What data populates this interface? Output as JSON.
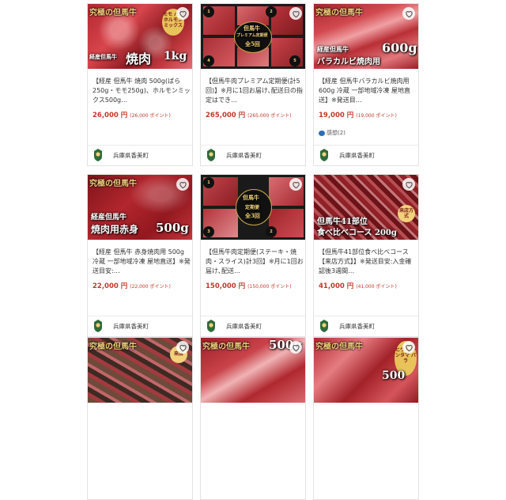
{
  "favorite_icon": "heart-icon",
  "review_icon": "speech-bubble-icon",
  "colors": {
    "price": "#c0392b",
    "review": "#2a6fb5",
    "banner_gold": "#f2d27a"
  },
  "products": [
    {
      "banner": "究極の但馬牛",
      "image_text": "焼肉",
      "image_text_2": "1kg",
      "image_sub": "経産但馬牛",
      "image_tag": "モモ バラ ホルモン ミックス",
      "title": "【経産 但馬牛 焼肉 500g(ばら250g・モモ250g)、ホルモンミックス500g…",
      "price": "26,000 円",
      "points": "(26,000 ポイント)",
      "review": "",
      "municipality": "兵庫県香美町"
    },
    {
      "banner": "",
      "image_text": "但馬牛",
      "image_text_2": "全5回",
      "image_sub": "プレミアム定期便",
      "image_tag": "",
      "title": "【但馬牛肉プレミアム定期便(計5回)】※月に1回お届け､配送日の指定はでき…",
      "price": "265,000 円",
      "points": "(265,000 ポイント)",
      "review": "",
      "municipality": "兵庫県香美町"
    },
    {
      "banner": "究極の但馬牛",
      "image_text": "600g",
      "image_text_2": "バラカルビ焼肉用",
      "image_sub": "経産但馬牛",
      "image_tag": "",
      "title": "【経産 但馬牛バラカルビ焼肉用600g 冷蔵 一部地域冷凍 屋地直送】※発送目…",
      "price": "19,000 円",
      "points": "(19,000 ポイント)",
      "review": "感想(2)",
      "municipality": "兵庫県香美町"
    },
    {
      "banner": "究極の但馬牛",
      "image_text": "500g",
      "image_text_2": "焼肉用赤身",
      "image_sub": "経産但馬牛",
      "image_tag": "",
      "title": "【経産 但馬牛 赤身焼肉用 500g 冷蔵 一部地域冷凍 屋地直送】※発送目安:…",
      "price": "22,000 円",
      "points": "(22,000 ポイント)",
      "review": "",
      "municipality": "兵庫県香美町"
    },
    {
      "banner": "",
      "image_text": "但馬牛",
      "image_text_2": "全3回",
      "image_sub": "定期便",
      "image_tag": "",
      "title": "【但馬牛肉定期便(ステーキ・焼肉・スライス)計3回】※月に1回お届け､配送…",
      "price": "150,000 円",
      "points": "(150,000 ポイント)",
      "review": "",
      "municipality": "兵庫県香美町"
    },
    {
      "banner": "",
      "image_text": "但馬牛41部位",
      "image_text_2": "食べ比べコース 200g",
      "image_sub": "",
      "image_tag": "来店方式",
      "title": "【但馬牛41部位食べ比べコース【来店方式】】※発送目安:入金確認後3週間…",
      "price": "41,000 円",
      "points": "(41,000 ポイント)",
      "review": "",
      "municipality": "兵庫県香美町"
    },
    {
      "banner": "究極の但馬牛",
      "image_text": "",
      "image_text_2": "",
      "image_sub": "",
      "image_tag": "来店",
      "title": "",
      "price": "",
      "points": "",
      "review": "",
      "municipality": ""
    },
    {
      "banner": "究極の但馬牛",
      "image_text": "500g",
      "image_text_2": "",
      "image_sub": "",
      "image_tag": "",
      "title": "",
      "price": "",
      "points": "",
      "review": "",
      "municipality": ""
    },
    {
      "banner": "究極の但馬牛",
      "image_text": "500",
      "image_text_2": "",
      "image_sub": "",
      "image_tag": "ヒウチ シンタマ バラ",
      "title": "",
      "price": "",
      "points": "",
      "review": "",
      "municipality": ""
    }
  ]
}
